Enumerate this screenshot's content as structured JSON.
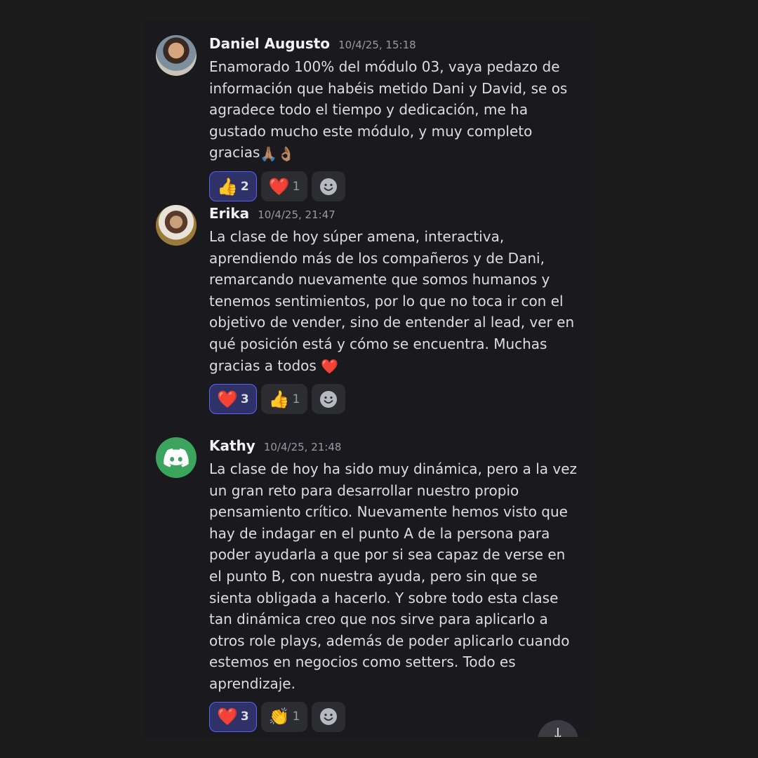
{
  "messages": [
    {
      "author": "Daniel Augusto",
      "timestamp": "10/4/25, 15:18",
      "text": "Enamorado 100% del módulo 03, vaya pedazo de información que habéis metido Dani y David, se os agradece todo el tiempo y dedicación, me ha gustado mucho este módulo, y muy completo gracias",
      "inline_emoji": "🙏🏽👌🏽",
      "reactions": [
        {
          "emoji": "👍",
          "count": "2",
          "active": true
        },
        {
          "emoji": "❤️",
          "count": "1",
          "active": false
        }
      ]
    },
    {
      "author": "Erika",
      "timestamp": "10/4/25, 21:47",
      "text": "La clase de hoy súper amena, interactiva, aprendiendo más de los compañeros y de Dani, remarcando nuevamente que somos humanos y tenemos sentimientos, por lo que no toca ir con el objetivo de vender, sino de entender al lead, ver en qué posición está y cómo se encuentra. Muchas gracias a todos",
      "inline_emoji": "❤️",
      "reactions": [
        {
          "emoji": "❤️",
          "count": "3",
          "active": true
        },
        {
          "emoji": "👍",
          "count": "1",
          "active": false
        }
      ]
    },
    {
      "author": "Kathy",
      "timestamp": "10/4/25, 21:48",
      "text": "La clase de hoy ha sido muy dinámica, pero a la vez un gran reto para desarrollar nuestro propio pensamiento crítico. Nuevamente hemos visto que hay de indagar en el punto A de la persona para poder ayudarla a que por si sea capaz de verse en el punto B, con nuestra ayuda, pero sin que se sienta obligada a hacerlo. Y sobre todo esta clase tan dinámica creo que nos sirve para aplicarlo a otros role plays, además de poder aplicarlo cuando estemos en negocios como setters. Todo es aprendizaje.",
      "inline_emoji": "",
      "reactions": [
        {
          "emoji": "❤️",
          "count": "3",
          "active": true
        },
        {
          "emoji": "👏",
          "count": "1",
          "active": false
        }
      ]
    }
  ],
  "icons": {
    "add_reaction": "smiley-face-icon",
    "discord_avatar": "discord-logo-icon",
    "scroll": "arrow-down-icon"
  },
  "colors": {
    "background": "#1c1c1c",
    "panel": "#1a1a1e",
    "active_reaction_border": "#5865f2",
    "discord_green": "#3ba55d"
  }
}
